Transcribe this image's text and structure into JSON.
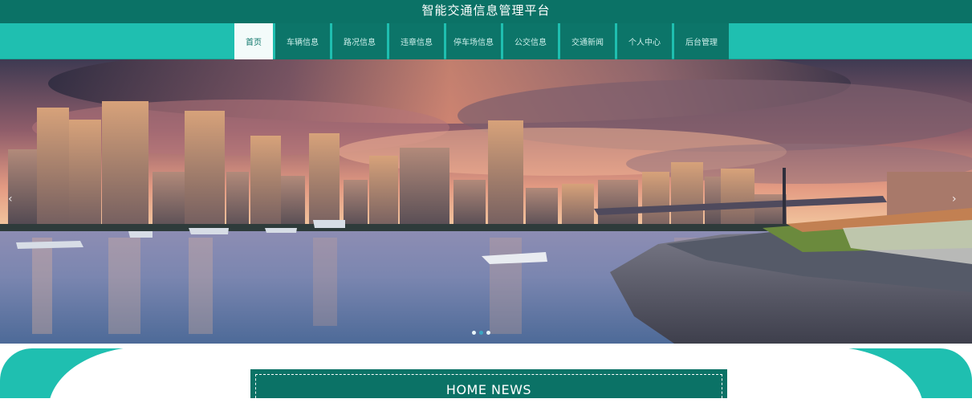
{
  "site": {
    "title": "智能交通信息管理平台"
  },
  "nav": {
    "items": [
      {
        "label": "首页",
        "active": true
      },
      {
        "label": "车辆信息",
        "active": false
      },
      {
        "label": "路况信息",
        "active": false
      },
      {
        "label": "违章信息",
        "active": false
      },
      {
        "label": "停车场信息",
        "active": false
      },
      {
        "label": "公交信息",
        "active": false
      },
      {
        "label": "交通新闻",
        "active": false
      },
      {
        "label": "个人中心",
        "active": false
      },
      {
        "label": "后台管理",
        "active": false
      }
    ]
  },
  "banner": {
    "prev_arrow": "‹",
    "next_arrow": "›",
    "slide_count": 3,
    "active_slide": 2
  },
  "news": {
    "title": "HOME NEWS"
  },
  "colors": {
    "dark_teal": "#0b7266",
    "light_teal": "#1fbfb0",
    "white": "#ffffff"
  }
}
